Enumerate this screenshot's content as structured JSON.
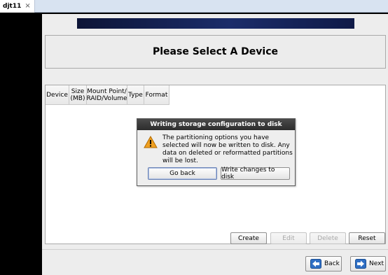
{
  "vm_tab": {
    "label": "djt11",
    "close_glyph": "×"
  },
  "installer": {
    "title": "Please Select A Device",
    "table_columns": [
      {
        "label": "Device"
      },
      {
        "label": "Size\n(MB)"
      },
      {
        "label": "Mount Point/\nRAID/Volume"
      },
      {
        "label": "Type"
      },
      {
        "label": "Format"
      }
    ],
    "buttons": {
      "create": "Create",
      "edit": "Edit",
      "delete": "Delete",
      "reset": "Reset",
      "back": "Back",
      "next": "Next"
    }
  },
  "dialog": {
    "title": "Writing storage configuration to disk",
    "message": "The partitioning options you have selected will now be written to disk.  Any data on deleted or reformatted partitions will be lost.",
    "go_back": "Go back",
    "write": "Write changes to disk",
    "icon": "warning-icon"
  },
  "colors": {
    "banner": "#1c2d6a",
    "warning": "#f0a020",
    "arrow": "#2f6fc4"
  }
}
